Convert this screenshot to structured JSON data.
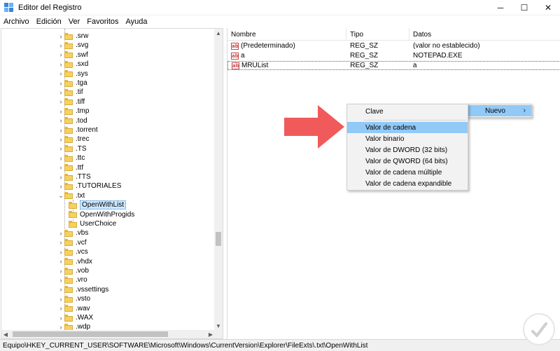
{
  "window": {
    "title": "Editor del Registro",
    "minimize_glyph": "─",
    "maximize_glyph": "☐",
    "close_glyph": "✕"
  },
  "menubar": {
    "items": [
      "Archivo",
      "Edición",
      "Ver",
      "Favoritos",
      "Ayuda"
    ]
  },
  "tree": {
    "items": [
      {
        "label": ".srw",
        "expanded": false,
        "level": 0
      },
      {
        "label": ".svg",
        "expanded": false,
        "level": 0
      },
      {
        "label": ".swf",
        "expanded": false,
        "level": 0
      },
      {
        "label": ".sxd",
        "expanded": false,
        "level": 0
      },
      {
        "label": ".sys",
        "expanded": false,
        "level": 0
      },
      {
        "label": ".tga",
        "expanded": false,
        "level": 0
      },
      {
        "label": ".tif",
        "expanded": false,
        "level": 0
      },
      {
        "label": ".tiff",
        "expanded": false,
        "level": 0
      },
      {
        "label": ".tmp",
        "expanded": false,
        "level": 0
      },
      {
        "label": ".tod",
        "expanded": false,
        "level": 0
      },
      {
        "label": ".torrent",
        "expanded": false,
        "level": 0
      },
      {
        "label": ".trec",
        "expanded": false,
        "level": 0
      },
      {
        "label": ".TS",
        "expanded": false,
        "level": 0
      },
      {
        "label": ".ttc",
        "expanded": false,
        "level": 0
      },
      {
        "label": ".ttf",
        "expanded": false,
        "level": 0
      },
      {
        "label": ".TTS",
        "expanded": false,
        "level": 0
      },
      {
        "label": ".TUTORIALES",
        "expanded": false,
        "level": 0
      },
      {
        "label": ".txt",
        "expanded": true,
        "level": 0
      },
      {
        "label": "OpenWithList",
        "selected": true,
        "level": 1
      },
      {
        "label": "OpenWithProgids",
        "level": 1
      },
      {
        "label": "UserChoice",
        "level": 1
      },
      {
        "label": ".vbs",
        "expanded": false,
        "level": 0
      },
      {
        "label": ".vcf",
        "expanded": false,
        "level": 0
      },
      {
        "label": ".vcs",
        "expanded": false,
        "level": 0
      },
      {
        "label": ".vhdx",
        "expanded": false,
        "level": 0
      },
      {
        "label": ".vob",
        "expanded": false,
        "level": 0
      },
      {
        "label": ".vro",
        "expanded": false,
        "level": 0
      },
      {
        "label": ".vssettings",
        "expanded": false,
        "level": 0
      },
      {
        "label": ".vsto",
        "expanded": false,
        "level": 0
      },
      {
        "label": ".wav",
        "expanded": false,
        "level": 0
      },
      {
        "label": ".WAX",
        "expanded": false,
        "level": 0
      },
      {
        "label": ".wdp",
        "expanded": false,
        "level": 0
      }
    ],
    "chevron_collapsed": "›",
    "chevron_expanded": "⌄"
  },
  "list": {
    "columns": [
      "Nombre",
      "Tipo",
      "Datos"
    ],
    "rows": [
      {
        "name": "(Predeterminado)",
        "type": "REG_SZ",
        "data": "(valor no establecido)"
      },
      {
        "name": "a",
        "type": "REG_SZ",
        "data": "NOTEPAD.EXE"
      },
      {
        "name": "MRUList",
        "type": "REG_SZ",
        "data": "a",
        "selected": true
      }
    ],
    "value_icon_text": "ab"
  },
  "context_menu": {
    "items": [
      "Clave",
      "Valor de cadena",
      "Valor binario",
      "Valor de DWORD (32 bits)",
      "Valor de QWORD (64 bits)",
      "Valor de cadena múltiple",
      "Valor de cadena expandible"
    ],
    "highlighted_index": 1
  },
  "parent_menu": {
    "label": "Nuevo",
    "arrow": "›"
  },
  "statusbar": {
    "path": "Equipo\\HKEY_CURRENT_USER\\SOFTWARE\\Microsoft\\Windows\\CurrentVersion\\Explorer\\FileExts\\.txt\\OpenWithList"
  },
  "colors": {
    "highlight": "#91c9f7",
    "selection": "#cce8ff",
    "arrow": "#f05a5a",
    "folder": "#f6d160"
  },
  "icons": {
    "app": "registry-editor-icon",
    "watermark": "watermark-logo"
  }
}
